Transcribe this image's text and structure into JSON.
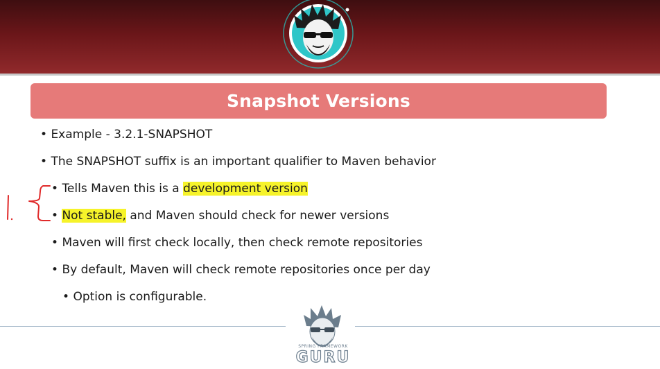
{
  "slide": {
    "title": "Snapshot Versions",
    "bullets": [
      {
        "text": "Example - 3.2.1-SNAPSHOT",
        "level": 1
      },
      {
        "text": "The SNAPSHOT suffix is an important qualifier to Maven behavior",
        "level": 1
      },
      {
        "prefix": "Tells Maven this is a ",
        "highlight": "development version",
        "suffix": "",
        "level": 2
      },
      {
        "prefix": "",
        "highlight": "Not stable,",
        "suffix": " and Maven should check for newer versions",
        "level": 2
      },
      {
        "text": "Maven will first check locally, then check remote repositories",
        "level": 2
      },
      {
        "text": "By default, Maven will check remote repositories once per day",
        "level": 2
      },
      {
        "text": "Option is configurable.",
        "level": 3
      }
    ],
    "bullet_glyph": "•"
  },
  "branding": {
    "footer_logo_top": "SPRING FRAMEWORK",
    "footer_logo_main": "GURU",
    "avatar_icon": "cartoon-avatar-sunglasses"
  },
  "annotation": {
    "handwritten_mark": "1."
  },
  "colors": {
    "header_dark": "#3e0e10",
    "header_light": "#922a2c",
    "title_bar": "#e67a79",
    "highlight": "#f6f32a",
    "annotation_ink": "#e02a2a"
  }
}
